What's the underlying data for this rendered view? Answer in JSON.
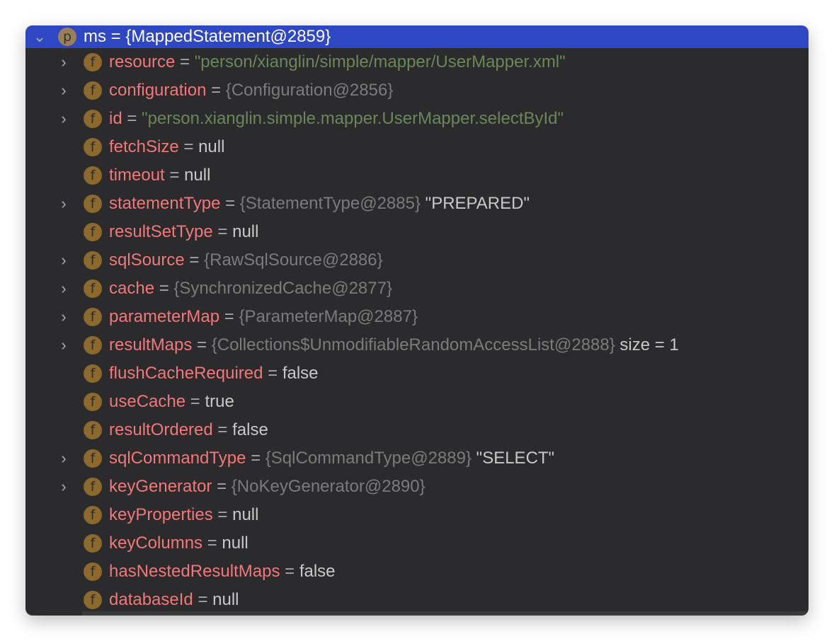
{
  "header": {
    "name": "ms",
    "value": "{MappedStatement@2859}",
    "badge": "p",
    "expanded": true
  },
  "fields": [
    {
      "name": "resource",
      "value": "\"person/xianglin/simple/mapper/UserMapper.xml\"",
      "kind": "str",
      "expandable": true
    },
    {
      "name": "configuration",
      "value": "{Configuration@2856}",
      "kind": "ref",
      "expandable": true
    },
    {
      "name": "id",
      "value": "\"person.xianglin.simple.mapper.UserMapper.selectById\"",
      "kind": "str",
      "expandable": true
    },
    {
      "name": "fetchSize",
      "value": "null",
      "kind": "val",
      "expandable": false
    },
    {
      "name": "timeout",
      "value": "null",
      "kind": "val",
      "expandable": false
    },
    {
      "name": "statementType",
      "value": "{StatementType@2885}",
      "extra": "\"PREPARED\"",
      "kind": "ref",
      "expandable": true
    },
    {
      "name": "resultSetType",
      "value": "null",
      "kind": "val",
      "expandable": false
    },
    {
      "name": "sqlSource",
      "value": "{RawSqlSource@2886}",
      "kind": "ref",
      "expandable": true
    },
    {
      "name": "cache",
      "value": "{SynchronizedCache@2877}",
      "kind": "ref",
      "expandable": true
    },
    {
      "name": "parameterMap",
      "value": "{ParameterMap@2887}",
      "kind": "ref",
      "expandable": true
    },
    {
      "name": "resultMaps",
      "value": "{Collections$UnmodifiableRandomAccessList@2888}",
      "extra": " size = 1",
      "kind": "ref",
      "expandable": true
    },
    {
      "name": "flushCacheRequired",
      "value": "false",
      "kind": "val",
      "expandable": false
    },
    {
      "name": "useCache",
      "value": "true",
      "kind": "val",
      "expandable": false
    },
    {
      "name": "resultOrdered",
      "value": "false",
      "kind": "val",
      "expandable": false
    },
    {
      "name": "sqlCommandType",
      "value": "{SqlCommandType@2889}",
      "extra": "\"SELECT\"",
      "kind": "ref",
      "expandable": true
    },
    {
      "name": "keyGenerator",
      "value": "{NoKeyGenerator@2890}",
      "kind": "ref",
      "expandable": true
    },
    {
      "name": "keyProperties",
      "value": "null",
      "kind": "val",
      "expandable": false
    },
    {
      "name": "keyColumns",
      "value": "null",
      "kind": "val",
      "expandable": false
    },
    {
      "name": "hasNestedResultMaps",
      "value": "false",
      "kind": "val",
      "expandable": false
    },
    {
      "name": "databaseId",
      "value": "null",
      "kind": "val",
      "expandable": false
    }
  ],
  "field_badge": "f",
  "equals": "=",
  "colors": {
    "selection": "#2f47c2",
    "field_name": "#f2777a",
    "string": "#6a8759",
    "reference": "#7b7b7b",
    "badge": "#8d6a2b"
  }
}
